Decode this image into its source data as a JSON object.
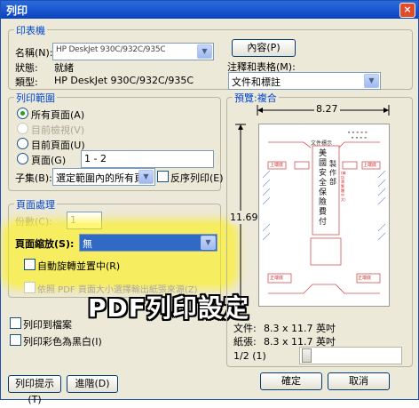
{
  "window": {
    "title": "列印",
    "close_glyph": "×"
  },
  "printer": {
    "group_label": "印表機",
    "name_label": "名稱(N):",
    "name_value": "HP DeskJet 930C/932C/935C",
    "status_label": "狀態:",
    "status_value": "就緒",
    "type_label": "類型:",
    "type_value": "HP DeskJet 930C/932C/935C",
    "properties_button": "內容(P)",
    "comments_label": "注釋和表格(M):",
    "comments_value": "文件和標註"
  },
  "range": {
    "group_label": "列印範圍",
    "all_pages": "所有頁面(A)",
    "current_view": "目前檢視(V)",
    "current_page": "目前頁面(U)",
    "pages": "頁面(G)",
    "pages_value": "1 - 2",
    "subset_label": "子集(B):",
    "subset_value": "選定範圍內的所有頁",
    "reverse": "反序列印(E)"
  },
  "handling": {
    "group_label": "頁面處理",
    "copies_label": "份數(C):",
    "copies_value": "1",
    "scaling_label": "頁面縮放(S):",
    "scaling_value": "無",
    "auto_rotate": "自動旋轉並置中(R)",
    "choose_source": "依照 PDF 頁面大小選擇輸出紙張來源(Z)"
  },
  "options": {
    "print_to_file": "列印到檔案",
    "grayscale": "列印彩色為黑白(I)"
  },
  "preview": {
    "label": "預覽:複合",
    "width_dim": "8.27",
    "height_dim": "11.69",
    "doc_label": "文件:",
    "doc_value": "8.3 x 11.7 英吋",
    "paper_label": "紙張:",
    "paper_value": "8.3 x 11.7 英吋",
    "page_indicator": "1/2 (1)",
    "content_main": "美國安全保險費付",
    "content_main2": "製作部",
    "content_stamp": "(鎮店寶繁體中文)",
    "side_labels": [
      "上端底",
      "上端底",
      "正端底",
      "正端底"
    ],
    "top_label": "文件標示"
  },
  "buttons": {
    "tips": "列印提示(T)",
    "advanced": "進階(D)",
    "ok": "確定",
    "cancel": "取消"
  },
  "overlay": {
    "caption": "PDF列印設定"
  },
  "colors": {
    "accent": "#0046d5",
    "title_bar": "#0a42c0",
    "highlight": "#fff000",
    "overlay_text": "#ffffff"
  }
}
